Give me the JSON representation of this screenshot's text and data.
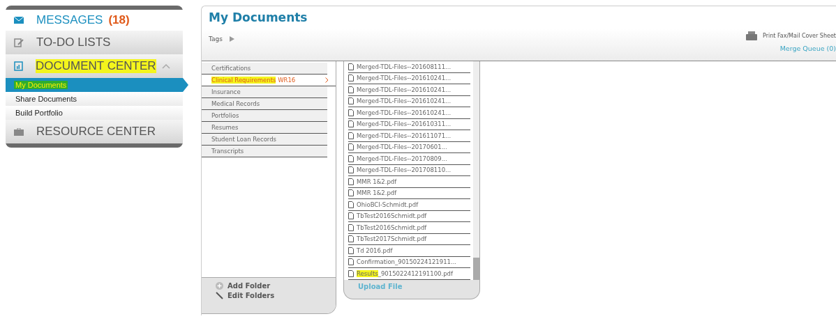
{
  "sidebar": {
    "items": [
      {
        "label": "MESSAGES",
        "count": "(18)",
        "highlighted": false,
        "expanded": false
      },
      {
        "label": "TO-DO LISTS",
        "highlighted": false,
        "expanded": false
      },
      {
        "label": "DOCUMENT CENTER",
        "highlighted": true,
        "expanded": true,
        "children": [
          {
            "label": "My Documents",
            "selected": true,
            "highlighted": true
          },
          {
            "label": "Share Documents",
            "selected": false,
            "highlighted": false
          },
          {
            "label": "Build Portfolio",
            "selected": false,
            "highlighted": false
          }
        ]
      },
      {
        "label": "RESOURCE CENTER",
        "highlighted": false,
        "expanded": false
      }
    ]
  },
  "main": {
    "title": "My Documents",
    "tags_label": "Tags",
    "print_label": "Print Fax/Mail Cover Sheet",
    "merge_queue": "Merge Queue (0)",
    "folders": [
      {
        "parts": [
          {
            "text": "Certifications",
            "highlighted": false
          }
        ],
        "selected": false
      },
      {
        "parts": [
          {
            "text": "Clinical Requirements",
            "highlighted": true
          },
          {
            "text": " WR16",
            "highlighted": false
          }
        ],
        "selected": true
      },
      {
        "parts": [
          {
            "text": "Insurance",
            "highlighted": false
          }
        ],
        "selected": false
      },
      {
        "parts": [
          {
            "text": "Medical Records",
            "highlighted": false
          }
        ],
        "selected": false
      },
      {
        "parts": [
          {
            "text": "Portfolios",
            "highlighted": false
          }
        ],
        "selected": false
      },
      {
        "parts": [
          {
            "text": "Resumes",
            "highlighted": false
          }
        ],
        "selected": false
      },
      {
        "parts": [
          {
            "text": "Student Loan Records",
            "highlighted": false
          }
        ],
        "selected": false
      },
      {
        "parts": [
          {
            "text": "Transcripts",
            "highlighted": false
          }
        ],
        "selected": false
      }
    ],
    "folder_actions": [
      "Add Folder",
      "Edit Folders"
    ],
    "files": [
      [
        {
          "text": "Merged-TDL-Files--201608111...",
          "highlighted": false
        }
      ],
      [
        {
          "text": "Merged-TDL-Files--201610241...",
          "highlighted": false
        }
      ],
      [
        {
          "text": "Merged-TDL-Files--201610241...",
          "highlighted": false
        }
      ],
      [
        {
          "text": "Merged-TDL-Files--201610241...",
          "highlighted": false
        }
      ],
      [
        {
          "text": "Merged-TDL-Files--201610241...",
          "highlighted": false
        }
      ],
      [
        {
          "text": "Merged-TDL-Files--201610311...",
          "highlighted": false
        }
      ],
      [
        {
          "text": "Merged-TDL-Files--201611071...",
          "highlighted": false
        }
      ],
      [
        {
          "text": "Merged-TDL-Files--20170601...",
          "highlighted": false
        }
      ],
      [
        {
          "text": "Merged-TDL-Files--20170809...",
          "highlighted": false
        }
      ],
      [
        {
          "text": "Merged-TDL-Files--201708110...",
          "highlighted": false
        }
      ],
      [
        {
          "text": "MMR 1&2.pdf",
          "highlighted": false
        }
      ],
      [
        {
          "text": "MMR 1&2.pdf",
          "highlighted": false
        }
      ],
      [
        {
          "text": "OhioBCI-Schmidt.pdf",
          "highlighted": false
        }
      ],
      [
        {
          "text": "TbTest2016Schmidt.pdf",
          "highlighted": false
        }
      ],
      [
        {
          "text": "TbTest2016Schmidt.pdf",
          "highlighted": false
        }
      ],
      [
        {
          "text": "TbTest2017Schmidt.pdf",
          "highlighted": false
        }
      ],
      [
        {
          "text": "Td 2016.pdf",
          "highlighted": false
        }
      ],
      [
        {
          "text": "Confirmation_90150224121911...",
          "highlighted": false
        }
      ],
      [
        {
          "text": "Results",
          "highlighted": true
        },
        {
          "text": "_9015022412191100.pdf",
          "highlighted": false
        }
      ]
    ],
    "upload_label": "Upload File"
  }
}
